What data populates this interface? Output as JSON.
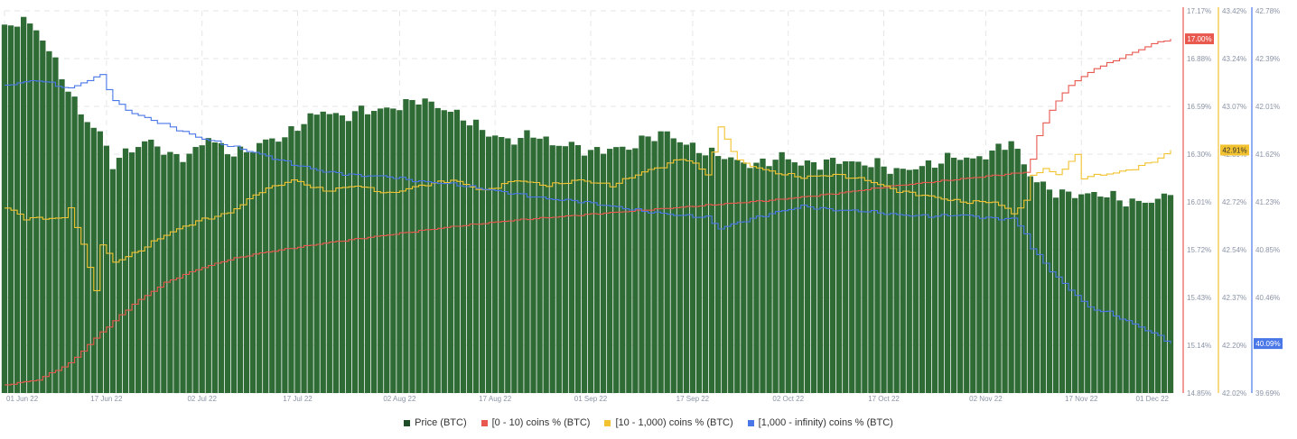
{
  "chart_data": {
    "type": "bar+line",
    "colors": {
      "price": "#2e6b35",
      "c0_10": "#e8584f",
      "c10_1000": "#f2c230",
      "c1000_inf": "#4a77e8",
      "grid": "#e6e6e6"
    },
    "x_ticks": [
      "01 Jun 22",
      "17 Jun 22",
      "02 Jul 22",
      "17 Jul 22",
      "02 Aug 22",
      "17 Aug 22",
      "01 Sep 22",
      "17 Sep 22",
      "02 Oct 22",
      "17 Oct 22",
      "02 Nov 22",
      "17 Nov 22",
      "01 Dec 22"
    ],
    "axes": {
      "red": {
        "ticks": [
          "17.17%",
          "16.88%",
          "16.59%",
          "16.30%",
          "16.01%",
          "15.72%",
          "15.43%",
          "15.14%",
          "14.85%"
        ],
        "ylim": [
          14.85,
          17.17
        ],
        "last_label": "17.00%"
      },
      "yellow": {
        "ticks": [
          "43.42%",
          "43.24%",
          "43.07%",
          "42.89%",
          "42.72%",
          "42.54%",
          "42.37%",
          "42.20%",
          "42.02%"
        ],
        "ylim": [
          42.02,
          43.42
        ],
        "last_label": "42.91%"
      },
      "blue": {
        "ticks": [
          "42.78%",
          "42.39%",
          "42.01%",
          "41.62%",
          "41.23%",
          "40.85%",
          "40.46%",
          "40.08%",
          "39.69%"
        ],
        "ylim": [
          39.69,
          42.78
        ],
        "last_label": "40.09%"
      }
    },
    "price_ylim": [
      0,
      100
    ],
    "series": [
      {
        "name": "Price (BTC)",
        "type": "bar",
        "x": [
          0,
          3,
          6,
          9,
          12,
          15,
          17,
          20,
          23,
          26,
          29,
          32,
          35,
          38,
          41,
          44,
          47,
          50,
          53,
          56,
          59,
          62,
          65,
          68,
          71,
          74,
          77,
          80,
          83,
          86,
          89,
          92,
          95,
          98,
          101,
          104,
          107,
          110,
          113,
          116,
          119,
          122,
          125,
          128,
          131,
          134,
          137,
          140,
          143,
          146,
          149,
          152,
          155,
          158,
          161,
          164,
          167,
          170,
          173,
          176,
          179,
          182,
          183
        ],
        "values": [
          95,
          98,
          93,
          83,
          73,
          68,
          60,
          64,
          66,
          62,
          62,
          67,
          63,
          63,
          66,
          67,
          71,
          74,
          72,
          74,
          74,
          75,
          77,
          75,
          73,
          70,
          67,
          66,
          68,
          65,
          65,
          63,
          64,
          64,
          67,
          68,
          65,
          63,
          62,
          60,
          60,
          62,
          60,
          60,
          61,
          60,
          60,
          58,
          59,
          60,
          62,
          61,
          63,
          66,
          57,
          53,
          52,
          52,
          52,
          50,
          50,
          51,
          53
        ]
      },
      {
        "name": "[0 - 10) coins % (BTC)",
        "type": "line",
        "x": [
          0,
          5,
          10,
          15,
          20,
          25,
          30,
          35,
          40,
          50,
          60,
          70,
          80,
          90,
          100,
          110,
          120,
          130,
          140,
          150,
          155,
          160,
          161,
          162,
          164,
          167,
          171,
          176,
          180,
          183
        ],
        "values": [
          14.9,
          14.93,
          15.03,
          15.22,
          15.39,
          15.52,
          15.6,
          15.66,
          15.7,
          15.76,
          15.81,
          15.86,
          15.9,
          15.93,
          15.96,
          15.99,
          16.02,
          16.06,
          16.11,
          16.15,
          16.17,
          16.19,
          16.27,
          16.41,
          16.57,
          16.72,
          16.82,
          16.9,
          16.97,
          17.0
        ]
      },
      {
        "name": "[10 - 1,000) coins % (BTC)",
        "type": "line",
        "x": [
          0,
          3,
          6,
          9,
          10,
          12,
          14,
          15,
          17,
          20,
          25,
          30,
          35,
          40,
          45,
          50,
          55,
          60,
          65,
          70,
          75,
          80,
          85,
          90,
          95,
          100,
          103,
          106,
          108,
          110,
          112,
          115,
          116,
          120,
          125,
          130,
          135,
          140,
          145,
          150,
          155,
          158,
          159,
          160,
          161,
          163,
          165,
          168,
          169,
          172,
          175,
          178,
          181,
          183
        ],
        "values": [
          42.7,
          42.66,
          42.66,
          42.66,
          42.7,
          42.56,
          42.4,
          42.56,
          42.5,
          42.53,
          42.6,
          42.65,
          42.68,
          42.76,
          42.8,
          42.76,
          42.78,
          42.75,
          42.78,
          42.8,
          42.76,
          42.8,
          42.78,
          42.8,
          42.78,
          42.83,
          42.85,
          42.88,
          42.86,
          42.82,
          42.99,
          42.87,
          42.86,
          42.83,
          42.81,
          42.82,
          42.8,
          42.76,
          42.74,
          42.72,
          42.72,
          42.68,
          42.7,
          42.72,
          42.82,
          42.84,
          42.82,
          42.89,
          42.81,
          42.82,
          42.83,
          42.85,
          42.88,
          42.91
        ]
      },
      {
        "name": "[1,000 - infinity) coins % (BTC)",
        "type": "line",
        "x": [
          0,
          5,
          10,
          12,
          15,
          17,
          20,
          25,
          30,
          35,
          40,
          45,
          50,
          55,
          60,
          65,
          70,
          75,
          80,
          85,
          90,
          95,
          100,
          105,
          110,
          112,
          115,
          120,
          125,
          130,
          135,
          140,
          145,
          150,
          155,
          158,
          159,
          160,
          161,
          163,
          165,
          168,
          170,
          173,
          176,
          179,
          182,
          183
        ],
        "values": [
          42.18,
          42.22,
          42.15,
          42.2,
          42.26,
          42.05,
          41.95,
          41.86,
          41.76,
          41.69,
          41.62,
          41.54,
          41.48,
          41.45,
          41.44,
          41.4,
          41.38,
          41.34,
          41.3,
          41.26,
          41.24,
          41.2,
          41.16,
          41.13,
          41.11,
          41.02,
          41.07,
          41.14,
          41.2,
          41.17,
          41.16,
          41.13,
          41.12,
          41.13,
          41.1,
          41.1,
          41.04,
          40.98,
          40.86,
          40.74,
          40.62,
          40.48,
          40.38,
          40.34,
          40.27,
          40.2,
          40.12,
          40.09
        ]
      }
    ]
  }
}
